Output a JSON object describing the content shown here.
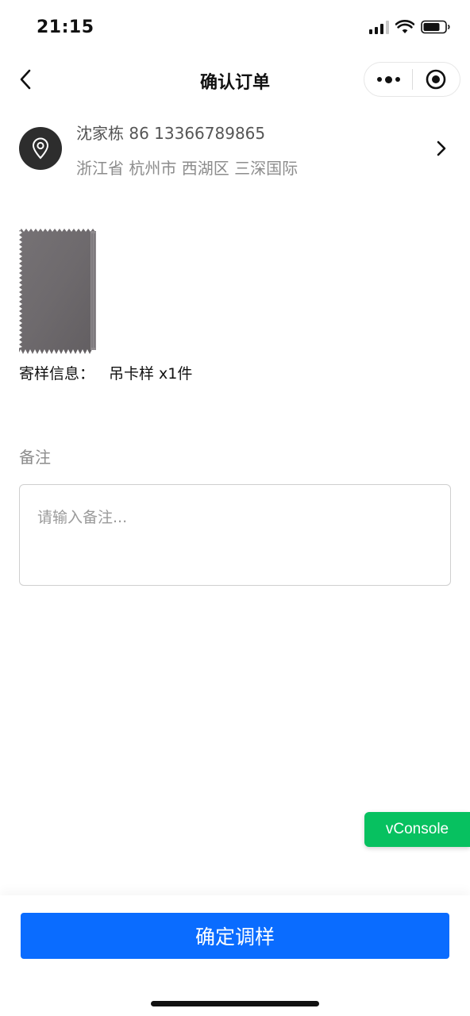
{
  "status_bar": {
    "time": "21:15",
    "icons": [
      "signal-icon",
      "wifi-icon",
      "battery-icon"
    ]
  },
  "nav": {
    "title": "确认订单",
    "icons": [
      "back-icon",
      "more-icon",
      "close-miniprogram-icon"
    ]
  },
  "address": {
    "name_phone": "沈家栋 86 13366789865",
    "detail": "浙江省 杭州市 西湖区 三深国际",
    "icons": [
      "location-pin-icon",
      "chevron-right-icon"
    ]
  },
  "sample": {
    "label": "寄样信息：",
    "value": "吊卡样 x1件",
    "swatch_color": "#6e6a6d"
  },
  "remark": {
    "label": "备注",
    "placeholder": "请输入备注..."
  },
  "vconsole": {
    "label": "vConsole",
    "color": "#07c160"
  },
  "footer": {
    "confirm_label": "确定调样",
    "button_color": "#0a6cff"
  }
}
